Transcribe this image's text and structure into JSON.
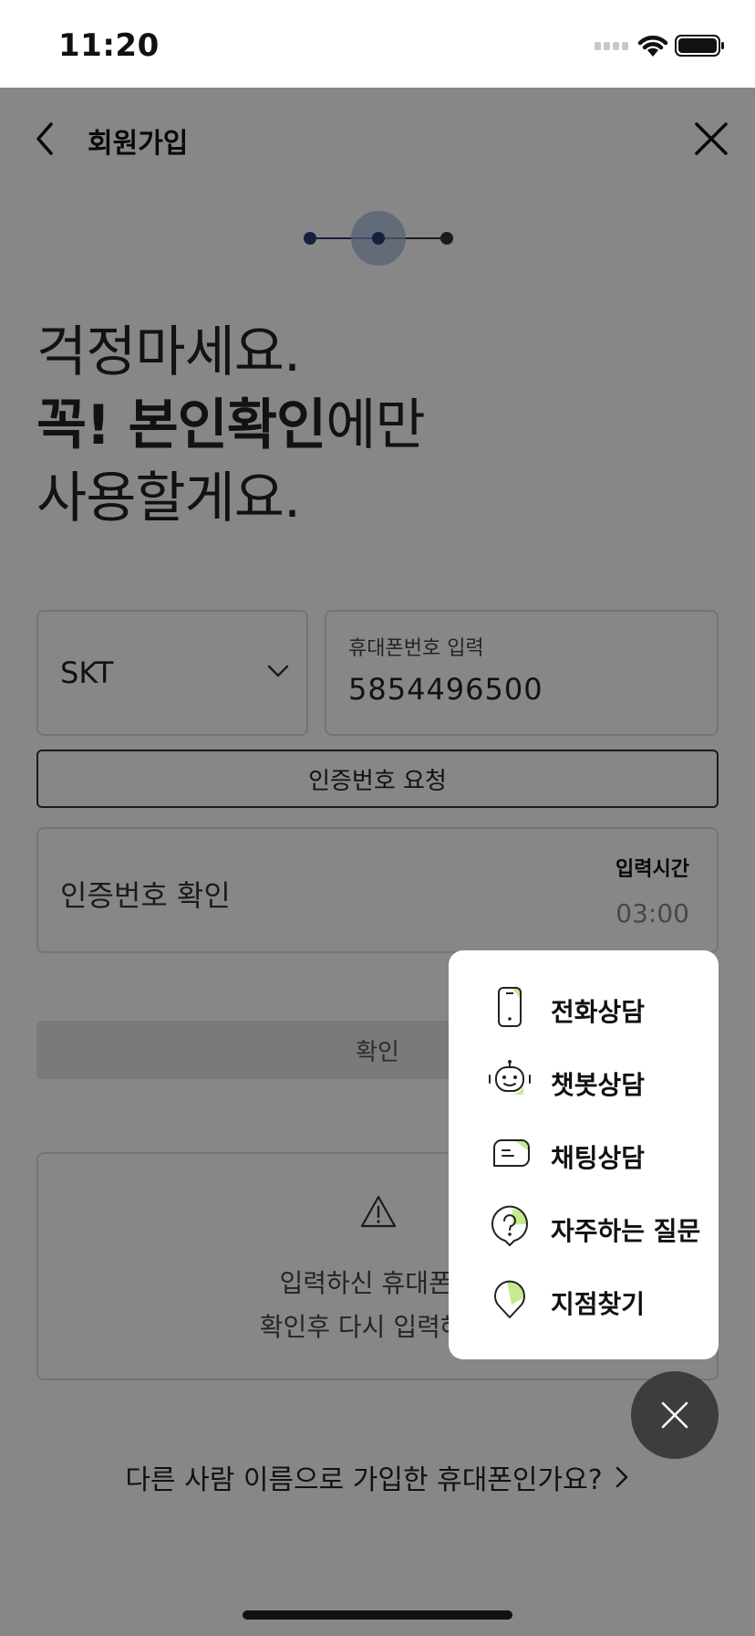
{
  "status_bar": {
    "time": "11:20"
  },
  "header": {
    "title": "회원가입"
  },
  "stepper": {
    "steps": 3,
    "current_step": 2,
    "colors": {
      "done": "#2a3f7a",
      "current": "#2a3f7a",
      "todo": "#333333",
      "halo": "#9fb2d6"
    }
  },
  "headline": {
    "line1": "걱정마세요.",
    "line2_bold": "꼭! 본인확인",
    "line2_rest": "에만",
    "line3": "사용할게요."
  },
  "form": {
    "carrier": {
      "value": "SKT"
    },
    "phone": {
      "label": "휴대폰번호 입력",
      "value": "5854496500"
    },
    "request_button": "인증번호 요청",
    "verify": {
      "placeholder": "인증번호 확인",
      "timer_label": "입력시간",
      "timer_value": "03:00"
    },
    "confirm_button": "확인"
  },
  "notice": {
    "line1": "입력하신 휴대폰번",
    "line2": "확인후 다시 입력해 주"
  },
  "other_link": "다른 사람 이름으로 가입한 휴대폰인가요?",
  "menu": {
    "accent_color": "#c6ea8f",
    "items": [
      {
        "label": "전화상담",
        "icon": "phone-icon"
      },
      {
        "label": "챗봇상담",
        "icon": "chatbot-icon"
      },
      {
        "label": "채팅상담",
        "icon": "chat-bubble-icon"
      },
      {
        "label": "자주하는 질문",
        "icon": "faq-icon"
      },
      {
        "label": "지점찾기",
        "icon": "location-pin-icon"
      }
    ]
  }
}
